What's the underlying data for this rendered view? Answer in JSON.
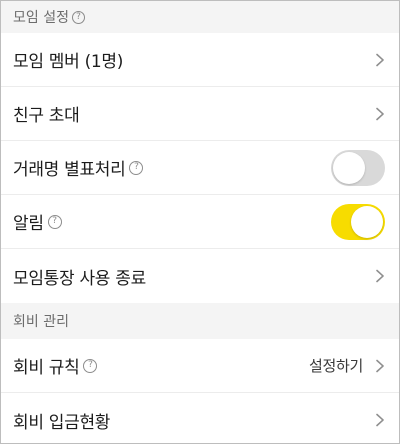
{
  "sections": {
    "group_settings": {
      "header": "모임 설정",
      "items": {
        "members": {
          "label": "모임 멤버 (1명)"
        },
        "invite": {
          "label": "친구 초대"
        },
        "trade_name": {
          "label": "거래명 별표처리",
          "toggle": "off"
        },
        "alarm": {
          "label": "알림",
          "toggle": "on"
        },
        "end_account": {
          "label": "모임통장 사용 종료"
        }
      }
    },
    "fee_management": {
      "header": "회비 관리",
      "items": {
        "fee_rules": {
          "label": "회비 규칙",
          "value": "설정하기"
        },
        "fee_status": {
          "label": "회비 입금현황"
        }
      }
    }
  },
  "help_glyph": "?",
  "colors": {
    "toggle_on": "#f7dc00",
    "toggle_off": "#d9d9d9",
    "section_bg": "#f4f4f4"
  },
  "icons": {
    "chevron": "chevron-right-icon",
    "help": "help-circle-icon"
  }
}
